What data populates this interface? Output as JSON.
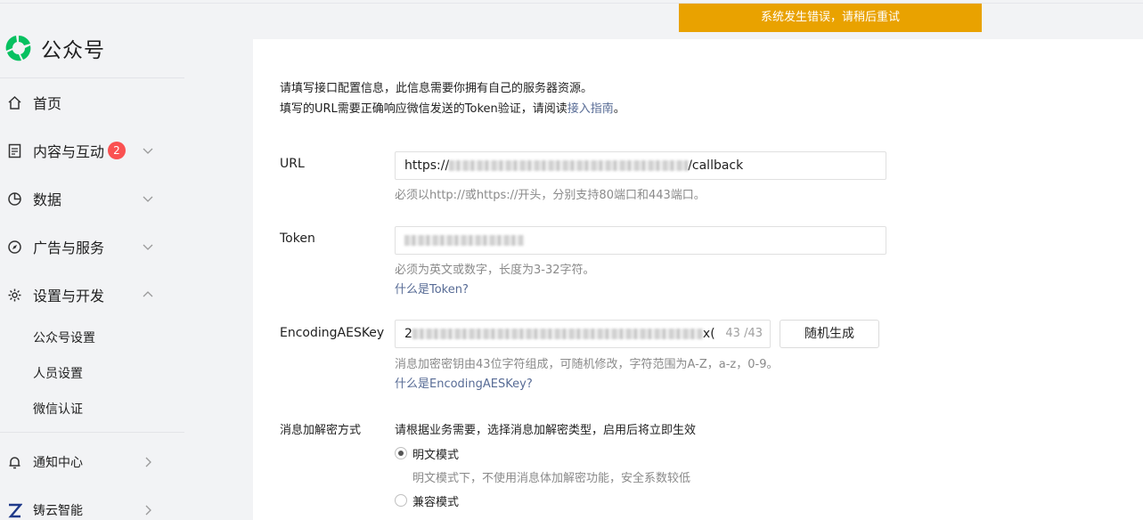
{
  "app": {
    "logo_text": "公众号",
    "brand_color": "#07c160"
  },
  "banner": {
    "error_text": "系统发生错误，请稍后重试",
    "color": "#e9a200"
  },
  "sidebar": {
    "items": [
      {
        "label": "首页",
        "icon": "home-icon"
      },
      {
        "label": "内容与互动",
        "icon": "document-icon",
        "badge": "2"
      },
      {
        "label": "数据",
        "icon": "pie-chart-icon"
      },
      {
        "label": "广告与服务",
        "icon": "compass-icon"
      },
      {
        "label": "设置与开发",
        "icon": "gear-icon"
      }
    ],
    "sub_items": [
      {
        "label": "公众号设置"
      },
      {
        "label": "人员设置"
      },
      {
        "label": "微信认证"
      }
    ],
    "bottom_items": [
      {
        "label": "通知中心",
        "icon": "bell-icon"
      },
      {
        "label": "铸云智能",
        "icon": "z-logo-icon"
      }
    ]
  },
  "intro": {
    "line1": "请填写接口配置信息，此信息需要你拥有自己的服务器资源。",
    "line2_prefix": "填写的URL需要正确响应微信发送的Token验证，请阅读",
    "line2_link": "接入指南",
    "line2_suffix": "。"
  },
  "form": {
    "url": {
      "label": "URL",
      "value_prefix": "https://",
      "value_suffix": "/callback",
      "hint": "必须以http://或https://开头，分别支持80端口和443端口。"
    },
    "token": {
      "label": "Token",
      "hint": "必须为英文或数字，长度为3-32字符。",
      "link": "什么是Token?"
    },
    "aes_key": {
      "label": "EncodingAESKey",
      "value_prefix": "2",
      "value_suffix": "x(",
      "counter": "43 /43",
      "generate_button": "随机生成",
      "hint": "消息加密密钥由43位字符组成，可随机修改，字符范围为A-Z，a-z，0-9。",
      "link": "什么是EncodingAESKey?"
    },
    "encryption": {
      "label": "消息加解密方式",
      "description": "请根据业务需要，选择消息加解密类型，启用后将立即生效",
      "options": [
        {
          "label": "明文模式",
          "desc": "明文模式下，不使用消息体加解密功能，安全系数较低",
          "selected": true
        },
        {
          "label": "兼容模式",
          "desc": "",
          "selected": false
        }
      ]
    }
  }
}
